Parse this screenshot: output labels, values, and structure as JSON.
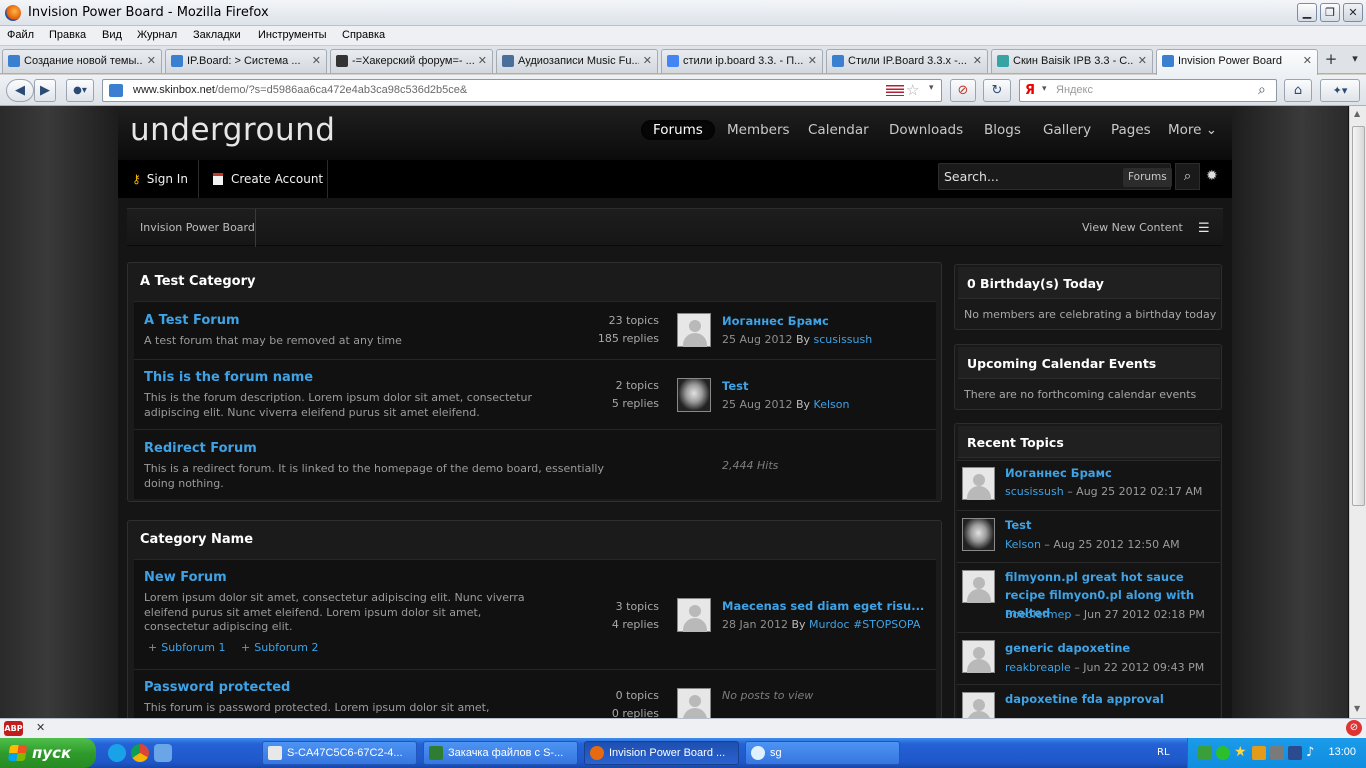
{
  "window": {
    "title": "Invision Power Board - Mozilla Firefox"
  },
  "menu": [
    "Файл",
    "Правка",
    "Вид",
    "Журнал",
    "Закладки",
    "Инструменты",
    "Справка"
  ],
  "tabs": [
    {
      "label": "Создание новой темы..."
    },
    {
      "label": "IP.Board: > Система ..."
    },
    {
      "label": "-=Хакерский форум=- ..."
    },
    {
      "label": "Аудиозаписи Music Fu..."
    },
    {
      "label": "стили ip.board 3.3. - П..."
    },
    {
      "label": "Стили IP.Board 3.3.x -..."
    },
    {
      "label": "Скин Baisik IPB 3.3 - С..."
    },
    {
      "label": "Invision Power Board"
    }
  ],
  "nav": {
    "url_host": "www.skinbox.net",
    "url_path": "/demo/?s=d5986aa6ca472e4ab3ca98c536d2b5ce&",
    "search_placeholder": "Яндекс",
    "search_engine": "Я"
  },
  "site": {
    "logo": "underground",
    "menu": [
      "Forums",
      "Members",
      "Calendar",
      "Downloads",
      "Blogs",
      "Gallery",
      "Pages",
      "More ⌄"
    ],
    "sign_in": "Sign In",
    "create_account": "Create Account",
    "search_placeholder": "Search...",
    "search_scope": "Forums",
    "breadcrumb": "Invision Power Board",
    "view_new_content": "View New Content"
  },
  "categories": [
    {
      "title": "A Test Category",
      "forums": [
        {
          "name": "A Test Forum",
          "desc": "A test forum that may be removed at any time",
          "topics": "23 topics",
          "replies": "185 replies",
          "last_title": "Иоганнес Брамс",
          "last_date": "25 Aug 2012",
          "last_by": "By",
          "last_user": "scusissush"
        },
        {
          "name": "This is the forum name",
          "desc": "This is the forum description. Lorem ipsum dolor sit amet, consectetur adipiscing elit. Nunc viverra eleifend purus sit amet eleifend.",
          "topics": "2 topics",
          "replies": "5 replies",
          "last_title": "Test",
          "last_date": "25 Aug 2012",
          "last_by": "By",
          "last_user": "Kelson"
        },
        {
          "name": "Redirect Forum",
          "desc": "This is a redirect forum. It is linked to the homepage of the demo board, essentially doing nothing.",
          "hits": "2,444 Hits"
        }
      ]
    },
    {
      "title": "Category Name",
      "forums": [
        {
          "name": "New Forum",
          "desc": "Lorem ipsum dolor sit amet, consectetur adipiscing elit. Nunc viverra eleifend purus sit amet eleifend. Lorem ipsum dolor sit amet, consectetur adipiscing elit.",
          "topics": "3 topics",
          "replies": "4 replies",
          "last_title": "Maecenas sed diam eget risu...",
          "last_date": "28 Jan 2012",
          "last_by": "By",
          "last_user": "Murdoc #STOPSOPA",
          "subforums": [
            "Subforum 1",
            "Subforum 2"
          ]
        },
        {
          "name": "Password protected",
          "desc": "This forum is password protected. Lorem ipsum dolor sit amet,",
          "topics": "0 topics",
          "replies": "0 replies",
          "no_posts": "No posts to view"
        }
      ]
    }
  ],
  "sidebar": {
    "birthdays_title": "0 Birthday(s) Today",
    "birthdays_text": "No members are celebrating a birthday today",
    "calendar_title": "Upcoming Calendar Events",
    "calendar_text": "There are no forthcoming calendar events",
    "recent_title": "Recent Topics",
    "recent": [
      {
        "title": "Иоганнес Брамс",
        "user": "scusissush",
        "date": "– Aug 25 2012 02:17 AM"
      },
      {
        "title": "Test",
        "user": "Kelson",
        "date": "– Aug 25 2012 12:50 AM"
      },
      {
        "title": "filmyonn.pl great hot sauce recipe filmyon0.pl along with melted",
        "user": "Boeolermep",
        "date": "– Jun 27 2012 02:18 PM"
      },
      {
        "title": "generic dapoxetine",
        "user": "reakbreaple",
        "date": "– Jun 22 2012 09:43 PM"
      },
      {
        "title": "dapoxetine fda approval",
        "user": "",
        "date": ""
      }
    ]
  },
  "addonbar": {
    "abp": "ABP"
  },
  "taskbar": {
    "start": "пуск",
    "buttons": [
      "S-CA47C5C6-67C2-4...",
      "Закачка файлов с S-...",
      "Invision Power Board ...",
      "sg"
    ],
    "lang": "RL",
    "clock": "13:00"
  },
  "colors": {
    "link": "#3ea2e5",
    "taskbar": "#2462d5",
    "start": "#2f9b2b"
  }
}
